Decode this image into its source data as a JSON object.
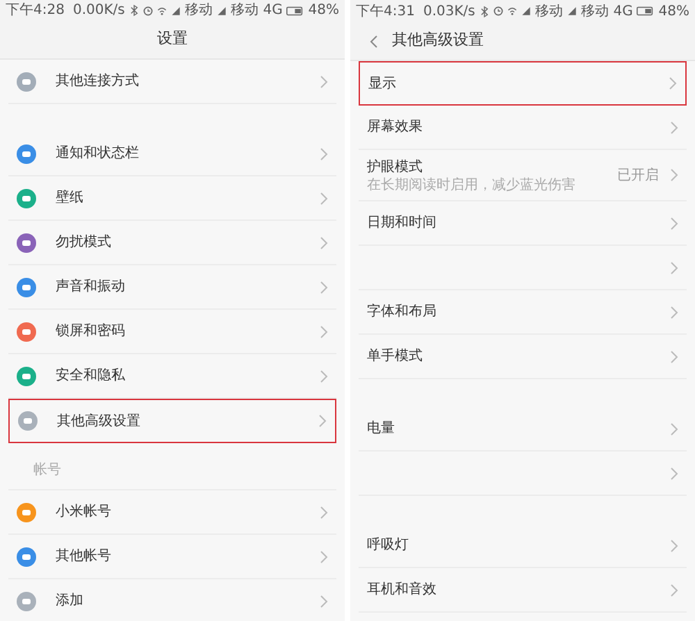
{
  "screens": [
    {
      "status_bar": {
        "time": "下午4:28",
        "speed": "0.00K/s",
        "carrier_1": "移动",
        "carrier_2": "移动 4G",
        "battery": "48%"
      },
      "header": {
        "title": "设置",
        "back": false
      },
      "rows": [
        {
          "kind": "item",
          "label": "其他连接方式",
          "color": "#a3adb8",
          "highlighted": false
        },
        {
          "kind": "spacer"
        },
        {
          "kind": "item",
          "label": "通知和状态栏",
          "color": "#3a8ee6",
          "highlighted": false
        },
        {
          "kind": "item",
          "label": "壁纸",
          "color": "#1bb08a",
          "highlighted": false
        },
        {
          "kind": "item",
          "label": "勿扰模式",
          "color": "#8a63b8",
          "highlighted": false
        },
        {
          "kind": "item",
          "label": "声音和振动",
          "color": "#3a8ee6",
          "highlighted": false
        },
        {
          "kind": "item",
          "label": "锁屏和密码",
          "color": "#f06a50",
          "highlighted": false
        },
        {
          "kind": "item",
          "label": "安全和隐私",
          "color": "#1bb08a",
          "highlighted": false
        },
        {
          "kind": "item",
          "label": "其他高级设置",
          "color": "#a9b1ba",
          "highlighted": true
        },
        {
          "kind": "section",
          "label": "帐号"
        },
        {
          "kind": "item",
          "label": "小米帐号",
          "color": "#f7941d",
          "highlighted": false
        },
        {
          "kind": "item",
          "label": "其他帐号",
          "color": "#3a8ee6",
          "highlighted": false
        },
        {
          "kind": "item",
          "label": "添加",
          "color": "#a9b1ba",
          "highlighted": false
        }
      ]
    },
    {
      "status_bar": {
        "time": "下午4:31",
        "speed": "0.03K/s",
        "carrier_1": "移动",
        "carrier_2": "移动 4G",
        "battery": "48%"
      },
      "header": {
        "title": "其他高级设置",
        "back": true
      },
      "rows": [
        {
          "kind": "plain",
          "label": "显示",
          "highlighted": true
        },
        {
          "kind": "plain",
          "label": "屏幕效果",
          "highlighted": false
        },
        {
          "kind": "plain",
          "label": "护眼模式",
          "subtitle": "在长期阅读时启用，减少蓝光伤害",
          "value": "已开启",
          "highlighted": false
        },
        {
          "kind": "plain",
          "label": "日期和时间",
          "highlighted": false
        },
        {
          "kind": "plain",
          "highlighted": false
        },
        {
          "kind": "plain",
          "label": "字体和布局",
          "highlighted": false
        },
        {
          "kind": "plain",
          "label": "单手模式",
          "highlighted": false
        },
        {
          "kind": "spacer"
        },
        {
          "kind": "plain",
          "label": "电量",
          "highlighted": false
        },
        {
          "kind": "plain",
          "highlighted": false
        },
        {
          "kind": "spacer"
        },
        {
          "kind": "plain",
          "label": "呼吸灯",
          "highlighted": false
        },
        {
          "kind": "plain",
          "label": "耳机和音效",
          "highlighted": false
        }
      ]
    }
  ]
}
